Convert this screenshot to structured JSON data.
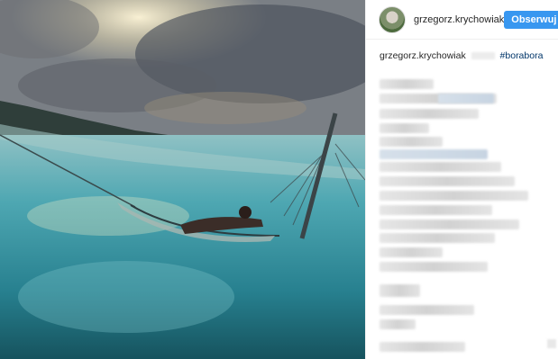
{
  "post": {
    "username": "grzegorz.krychowiak",
    "follow_label": "Obserwuj",
    "caption_username": "grzegorz.krychowiak",
    "caption_hashtag": "#borabora"
  }
}
